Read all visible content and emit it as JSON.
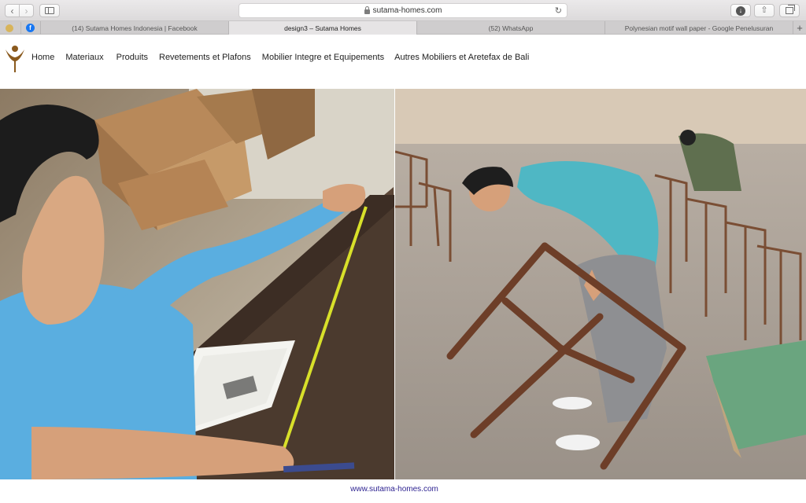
{
  "browser": {
    "url": "sutama-homes.com",
    "icons": {
      "back": "chevron-left-icon",
      "forward": "chevron-right-icon",
      "sidebar": "sidebar-icon",
      "lock": "lock-icon",
      "reload": "reload-icon",
      "download": "download-icon",
      "share": "share-icon",
      "tabs": "tabs-overview-icon",
      "new_tab": "plus-icon"
    },
    "tabs": [
      {
        "label": "(14) Sutama Homes Indonesia | Facebook",
        "active": false
      },
      {
        "label": "design3 – Sutama Homes",
        "active": true
      },
      {
        "label": "(52) WhatsApp",
        "active": false
      },
      {
        "label": "Polynesian motif wall paper - Google Penelusuran",
        "active": false
      }
    ]
  },
  "site": {
    "nav": [
      "Home",
      "Materiaux",
      "Produits",
      "Revetements et Plafons",
      "Mobilier Integre et Equipements",
      "Autres Mobiliers et Aretefax de Bali"
    ],
    "footer_link": "www.sutama-homes.com",
    "colors": {
      "logo": "#8a5a1e",
      "footer_link": "#2a1f8f"
    }
  }
}
